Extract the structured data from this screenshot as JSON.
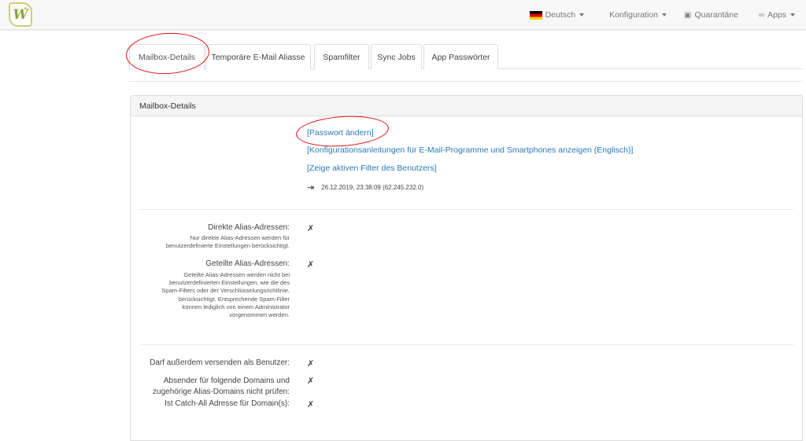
{
  "navbar": {
    "language": "Deutsch",
    "config": "Konfiguration",
    "quarantine": "Quarantäne",
    "apps": "Apps",
    "logo_letter": "W"
  },
  "tabs": [
    {
      "label": "Mailbox-Details",
      "active": true
    },
    {
      "label": "Temporäre E-Mail Aliasse",
      "active": false
    },
    {
      "label": "Spamfilter",
      "active": false
    },
    {
      "label": "Sync Jobs",
      "active": false
    },
    {
      "label": "App Passwörter",
      "active": false
    }
  ],
  "panel": {
    "title": "Mailbox-Details",
    "links": {
      "change_password": "[Passwort ändern]",
      "config_guides": "[Konfigurationsanleitungen für E-Mail-Programme und Smartphones anzeigen (Englisch)]",
      "active_filter": "[Zeige aktiven Filter des Benutzers]"
    },
    "last_login": "26.12.2019, 23:38:09 (62.245.232.0)",
    "direct_alias": {
      "label": "Direkte Alias-Adressen:",
      "help": [
        "Nur direkte Alias-Adressen werden für",
        "benutzerdefinierte Einstellungen berücksichtigt."
      ],
      "value": "✗"
    },
    "shared_alias": {
      "label": "Geteilte Alias-Adressen:",
      "help": [
        "Geteilte Alias-Adressen werden nicht bei",
        "benutzerdefinierten Einstellungen, wie die des",
        "Spam-Filters oder der Verschlüsselungsrichtlinie,",
        "berücksichtigt. Entsprechende Spam-Filter",
        "können lediglich von einem Administrator",
        "vorgenommen werden."
      ],
      "value": "✗"
    },
    "send_as": {
      "label": "Darf außerdem versenden als Benutzer:",
      "value": "✗"
    },
    "sender_check": {
      "label": [
        "Absender für folgende Domains und",
        "zugehörige Alias-Domains nicht prüfen:"
      ],
      "value": "✗"
    },
    "catch_all": {
      "label": "Ist Catch-All Adresse für Domain(s):",
      "value": "✗"
    }
  }
}
